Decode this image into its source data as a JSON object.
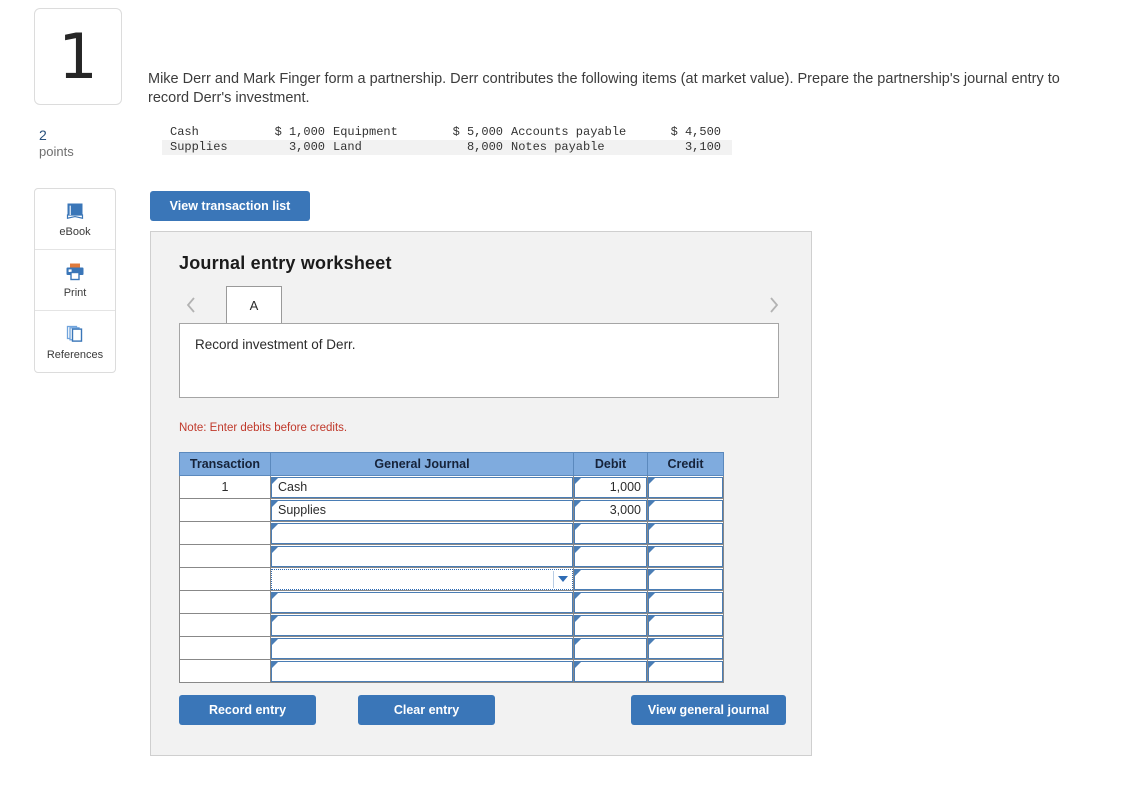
{
  "question_number": "1",
  "points": {
    "value": "2",
    "label": "points"
  },
  "tools": [
    {
      "name": "ebook",
      "label": "eBook"
    },
    {
      "name": "print",
      "label": "Print"
    },
    {
      "name": "references",
      "label": "References"
    }
  ],
  "question": {
    "text": "Mike Derr and Mark Finger form a partnership. Derr contributes the following items (at market value). Prepare the partnership's journal entry to record Derr's investment."
  },
  "figure": {
    "rows": [
      {
        "item1": "Cash",
        "amount1": "$ 1,000",
        "item2": "Equipment",
        "amount2": "$ 5,000",
        "item3": "Accounts payable",
        "amount3": "$ 4,500"
      },
      {
        "item1": "Supplies",
        "amount1": "3,000",
        "item2": "Land",
        "amount2": "8,000",
        "item3": "Notes payable",
        "amount3": "3,100"
      }
    ]
  },
  "buttons": {
    "view_transaction_list": "View transaction list",
    "record_entry": "Record entry",
    "clear_entry": "Clear entry",
    "view_general_journal": "View general journal"
  },
  "worksheet": {
    "title": "Journal entry worksheet",
    "tab": "A",
    "prev_arrow": "‹",
    "next_arrow": "›",
    "description": "Record investment of Derr.",
    "note": "Note: Enter debits before credits."
  },
  "journal": {
    "headers": [
      "Transaction",
      "General Journal",
      "Debit",
      "Credit"
    ],
    "rows": [
      {
        "transaction": "1",
        "account": "Cash",
        "debit": "1,000",
        "credit": "",
        "dropdown": false
      },
      {
        "transaction": "",
        "account": "Supplies",
        "debit": "3,000",
        "credit": "",
        "dropdown": false
      },
      {
        "transaction": "",
        "account": "",
        "debit": "",
        "credit": "",
        "dropdown": false
      },
      {
        "transaction": "",
        "account": "",
        "debit": "",
        "credit": "",
        "dropdown": false
      },
      {
        "transaction": "",
        "account": "",
        "debit": "",
        "credit": "",
        "dropdown": true
      },
      {
        "transaction": "",
        "account": "",
        "debit": "",
        "credit": "",
        "dropdown": false
      },
      {
        "transaction": "",
        "account": "",
        "debit": "",
        "credit": "",
        "dropdown": false
      },
      {
        "transaction": "",
        "account": "",
        "debit": "",
        "credit": "",
        "dropdown": false
      },
      {
        "transaction": "",
        "account": "",
        "debit": "",
        "credit": "",
        "dropdown": false
      }
    ]
  },
  "colors": {
    "accent_blue": "#3a76b8",
    "header_blue": "#7fabde",
    "cell_border_blue": "#4a7db5",
    "note_red": "#c0392b",
    "panel_bg": "#f2f2f2"
  }
}
